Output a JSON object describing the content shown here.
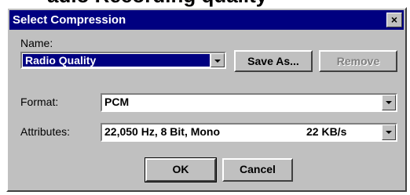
{
  "page_caption": "adio Recording quality",
  "dialog": {
    "title": "Select Compression",
    "close_glyph": "×",
    "name_label": "Name:",
    "name_value": "Radio Quality",
    "save_as_label": "Save As...",
    "remove_label": "Remove",
    "format_label": "Format:",
    "format_value": "PCM",
    "attributes_label": "Attributes:",
    "attributes_value": "22,050 Hz, 8 Bit, Mono",
    "attributes_rate": "22 KB/s",
    "ok_label": "OK",
    "cancel_label": "Cancel"
  },
  "colors": {
    "title_bar": "#000080",
    "dialog_face": "#c0c0c0",
    "selection": "#000080"
  },
  "icons": {
    "close": "close-icon",
    "dropdown": "chevron-down-icon"
  }
}
